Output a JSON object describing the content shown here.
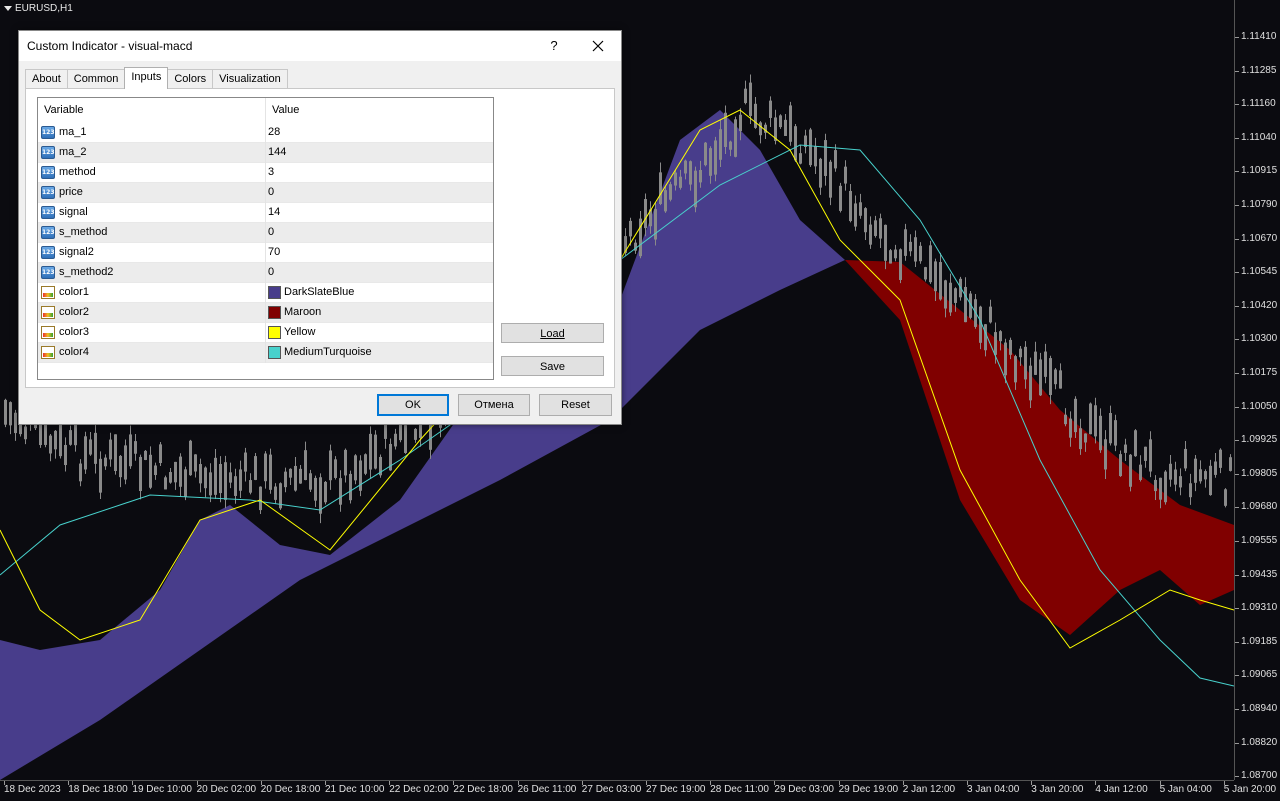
{
  "chart": {
    "symbol": "EURUSD,H1",
    "price_labels": [
      "1.11410",
      "1.11285",
      "1.11160",
      "1.11040",
      "1.10915",
      "1.10790",
      "1.10670",
      "1.10545",
      "1.10420",
      "1.10300",
      "1.10175",
      "1.10050",
      "1.09925",
      "1.09805",
      "1.09680",
      "1.09555",
      "1.09435",
      "1.09310",
      "1.09185",
      "1.09065",
      "1.08940",
      "1.08820",
      "1.08700"
    ],
    "time_labels": [
      "18 Dec 2023",
      "18 Dec 18:00",
      "19 Dec 10:00",
      "20 Dec 02:00",
      "20 Dec 18:00",
      "21 Dec 10:00",
      "22 Dec 02:00",
      "22 Dec 18:00",
      "26 Dec 11:00",
      "27 Dec 03:00",
      "27 Dec 19:00",
      "28 Dec 11:00",
      "29 Dec 03:00",
      "29 Dec 19:00",
      "2 Jan 12:00",
      "3 Jan 04:00",
      "3 Jan 20:00",
      "4 Jan 12:00",
      "5 Jan 04:00",
      "5 Jan 20:00"
    ],
    "colors": {
      "background": "#0b0b10",
      "bull_band": "#483D8B",
      "bear_band": "#800000",
      "signal_line": "#FFFF00",
      "signal2_line": "#48D1CC",
      "candles": "#8a8a8a"
    }
  },
  "dialog": {
    "title": "Custom Indicator - visual-macd",
    "help_label": "?",
    "tabs": [
      {
        "label": "About"
      },
      {
        "label": "Common"
      },
      {
        "label": "Inputs",
        "active": true
      },
      {
        "label": "Colors"
      },
      {
        "label": "Visualization"
      }
    ],
    "table": {
      "col_variable": "Variable",
      "col_value": "Value",
      "rows": [
        {
          "name": "ma_1",
          "value": "28",
          "kind": "number"
        },
        {
          "name": "ma_2",
          "value": "144",
          "kind": "number"
        },
        {
          "name": "method",
          "value": "3",
          "kind": "number"
        },
        {
          "name": "price",
          "value": "0",
          "kind": "number"
        },
        {
          "name": "signal",
          "value": "14",
          "kind": "number"
        },
        {
          "name": "s_method",
          "value": "0",
          "kind": "number"
        },
        {
          "name": "signal2",
          "value": "70",
          "kind": "number"
        },
        {
          "name": "s_method2",
          "value": "0",
          "kind": "number"
        },
        {
          "name": "color1",
          "value": "DarkSlateBlue",
          "kind": "color",
          "swatch": "#483D8B"
        },
        {
          "name": "color2",
          "value": "Maroon",
          "kind": "color",
          "swatch": "#800000"
        },
        {
          "name": "color3",
          "value": "Yellow",
          "kind": "color",
          "swatch": "#FFFF00"
        },
        {
          "name": "color4",
          "value": "MediumTurquoise",
          "kind": "color",
          "swatch": "#48D1CC"
        }
      ]
    },
    "load_label": "Load",
    "save_label": "Save",
    "ok_label": "OK",
    "cancel_label": "Отмена",
    "reset_label": "Reset"
  }
}
